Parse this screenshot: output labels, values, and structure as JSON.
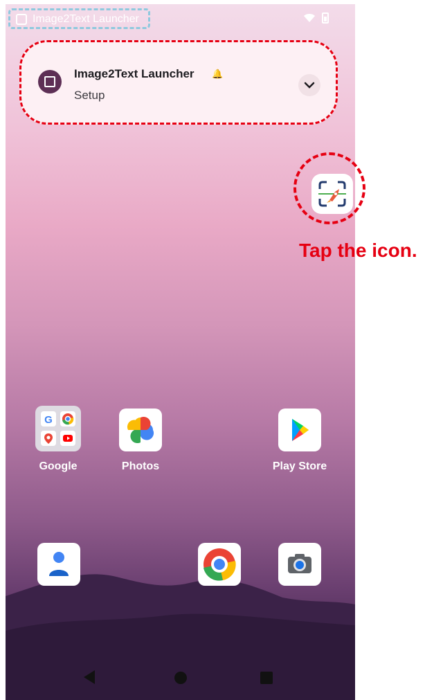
{
  "status_bar": {
    "app_label": "Image2Text Launcher",
    "icons": [
      "wifi-icon",
      "battery-icon"
    ]
  },
  "notification": {
    "title": "Image2Text Launcher",
    "subtitle": "Setup",
    "icon": "image2text-icon",
    "expand_icon": "chevron-down-icon"
  },
  "floating_icon": {
    "name": "image2text-launcher-icon",
    "instruction": "Tap the icon."
  },
  "home": {
    "row1": [
      {
        "label": "Google",
        "icon": "google-folder-icon"
      },
      {
        "label": "Photos",
        "icon": "photos-icon"
      },
      {
        "label": "Play Store",
        "icon": "play-store-icon"
      }
    ],
    "row2": [
      {
        "icon": "contacts-icon"
      },
      {
        "icon": "chrome-icon"
      },
      {
        "icon": "camera-icon"
      }
    ]
  },
  "navbar": {
    "buttons": [
      "back-icon",
      "home-icon",
      "recents-icon"
    ]
  },
  "colors": {
    "annotation_red": "#e60012",
    "annotation_blue": "#8ec9de"
  }
}
